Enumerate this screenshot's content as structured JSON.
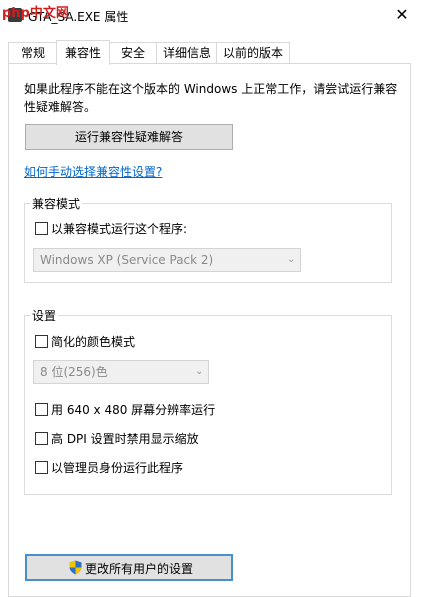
{
  "window": {
    "title": "GTA_SA.EXE 属性",
    "close_glyph": "✕",
    "watermark": "php中文网"
  },
  "tabs": [
    {
      "label": "常规",
      "active": false
    },
    {
      "label": "兼容性",
      "active": true
    },
    {
      "label": "安全",
      "active": false
    },
    {
      "label": "详细信息",
      "active": false
    },
    {
      "label": "以前的版本",
      "active": false
    }
  ],
  "compat": {
    "description": "如果此程序不能在这个版本的 Windows 上正常工作，请尝试运行兼容性疑难解答。",
    "troubleshoot_button": "运行兼容性疑难解答",
    "manual_link": "如何手动选择兼容性设置?"
  },
  "mode_group": {
    "legend": "兼容模式",
    "checkbox_label": "以兼容模式运行这个程序:",
    "checked": false,
    "select_value": "Windows XP (Service Pack 2)",
    "select_enabled": false
  },
  "settings_group": {
    "legend": "设置",
    "reduced_color_label": "简化的颜色模式",
    "color_select_value": "8 位(256)色",
    "res_640_label": "用 640 x 480 屏幕分辨率运行",
    "dpi_label": "高 DPI 设置时禁用显示缩放",
    "admin_label": "以管理员身份运行此程序"
  },
  "footer": {
    "all_users_button": "更改所有用户的设置",
    "icon": "uac-shield-icon"
  },
  "colors": {
    "link": "#0066cc",
    "button_bg": "#e1e1e1",
    "focus_border": "#4a90c8",
    "disabled_text": "#8a8a8a"
  }
}
